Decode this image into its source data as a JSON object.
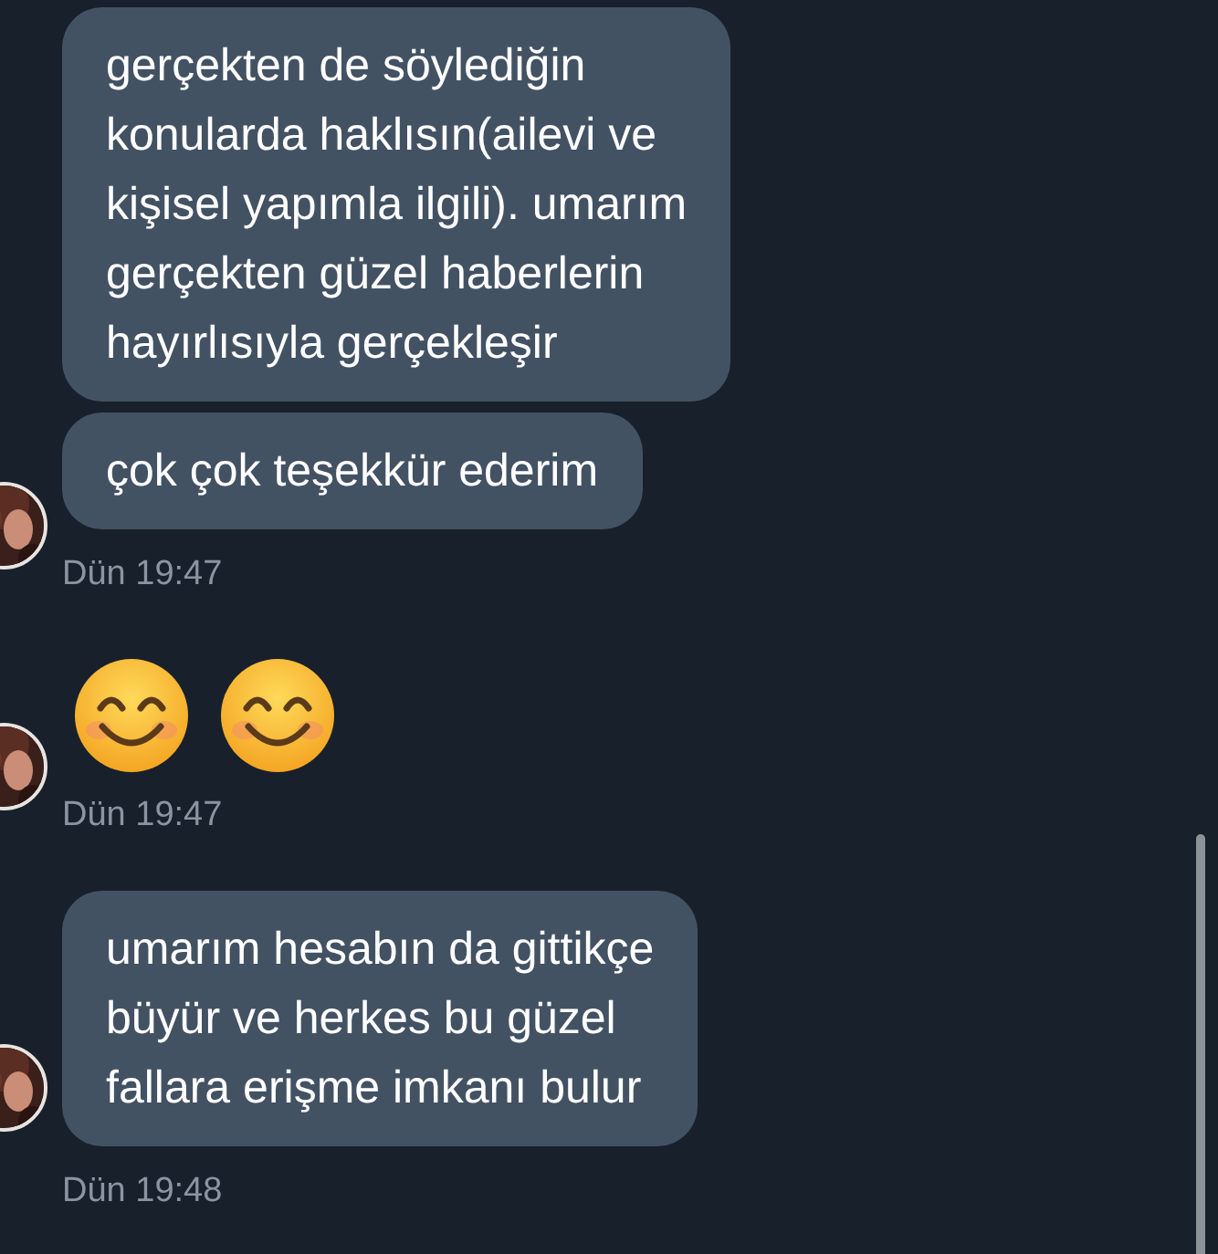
{
  "messages": [
    {
      "kind": "text",
      "avatar": false,
      "lines": [
        "gerçekten de söylediğin",
        "konularda haklısın(ailevi ve",
        "kişisel yapımla ilgili). umarım",
        "gerçekten güzel haberlerin",
        "hayırlısıyla gerçekleşir"
      ]
    },
    {
      "kind": "text",
      "avatar": true,
      "lines": [
        "çok çok teşekkür ederim"
      ],
      "time": "Dün 19:47"
    },
    {
      "kind": "emoji",
      "avatar": true,
      "emojis": [
        {
          "kind": "smiling-face"
        },
        {
          "kind": "smiling-face"
        }
      ],
      "time": "Dün 19:47"
    },
    {
      "kind": "text",
      "avatar": true,
      "lines": [
        "umarım hesabın da gittikçe",
        "büyür ve herkes bu güzel",
        "fallara erişme imkanı bulur"
      ],
      "time": "Dün 19:48"
    }
  ]
}
